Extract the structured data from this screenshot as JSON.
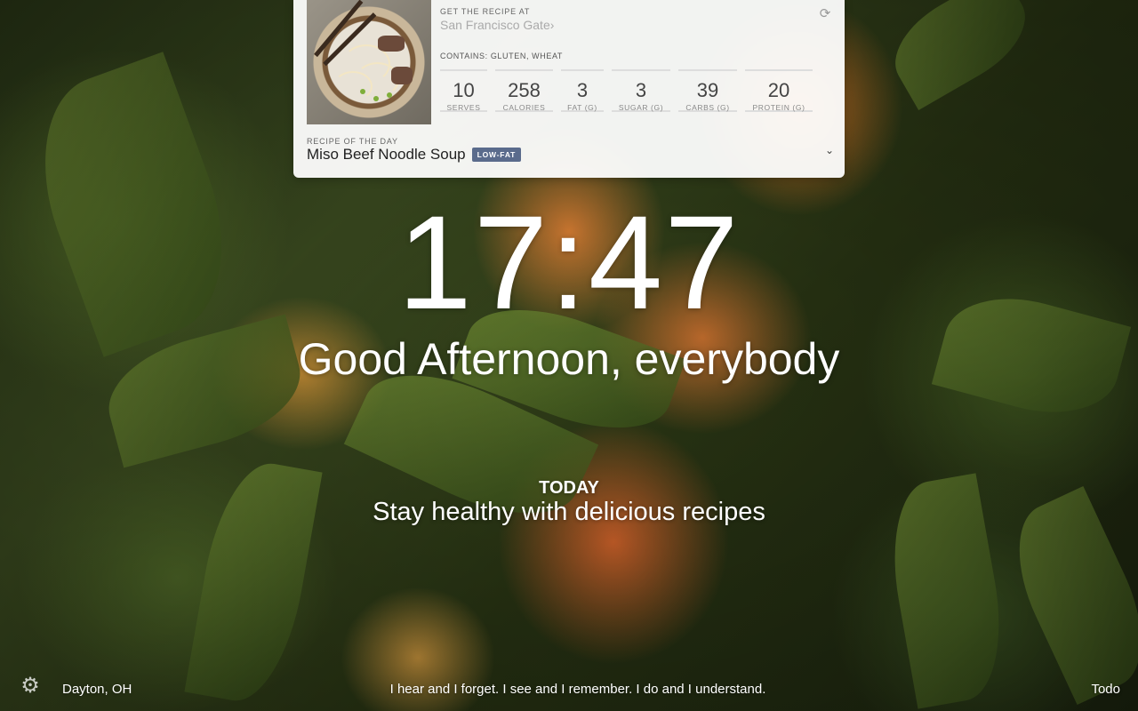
{
  "recipe": {
    "source_label": "GET THE RECIPE AT",
    "source_name": "San Francisco Gate",
    "source_chevron": "›",
    "contains": "CONTAINS: GLUTEN, WHEAT",
    "stats": [
      {
        "value": "10",
        "label": "SERVES"
      },
      {
        "value": "258",
        "label": "CALORIES"
      },
      {
        "value": "3",
        "label": "FAT (G)"
      },
      {
        "value": "3",
        "label": "SUGAR (G)"
      },
      {
        "value": "39",
        "label": "CARBS (G)"
      },
      {
        "value": "20",
        "label": "PROTEIN (G)"
      }
    ],
    "rotd_label": "RECIPE OF THE DAY",
    "title": "Miso Beef Noodle Soup",
    "badge": "LOW-FAT",
    "refresh_icon": "refresh-icon",
    "expand_icon": "chevron-down-icon",
    "expand_glyph": "⌄",
    "refresh_glyph": "⟳",
    "badge_color": "#5a6b8c"
  },
  "clock": {
    "time": "17:47"
  },
  "greeting": "Good Afternoon, everybody",
  "focus": {
    "label": "TODAY",
    "text": "Stay healthy with delicious recipes"
  },
  "bottom": {
    "settings_icon": "gear-icon",
    "settings_glyph": "⚙",
    "location": "Dayton, OH",
    "quote": "I hear and I forget. I see and I remember. I do and I understand.",
    "todo": "Todo"
  }
}
